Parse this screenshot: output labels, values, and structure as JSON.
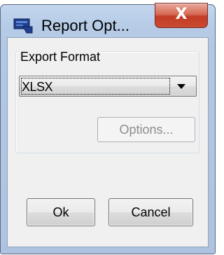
{
  "window": {
    "title": "Report Opt...",
    "icon": "report-app-icon",
    "close_icon": "close-icon",
    "close_glyph": "X"
  },
  "export_group": {
    "label": "Export Format",
    "format_select": {
      "selected_value": "XLSX",
      "arrow_icon": "chevron-down-icon"
    },
    "options_button": {
      "label": "Options...",
      "enabled": false
    }
  },
  "footer": {
    "ok_label": "Ok",
    "cancel_label": "Cancel"
  },
  "colors": {
    "title_bar": "#b6cbe6",
    "close_button": "#c94a32",
    "dialog_background": "#f0f0f0",
    "disabled_text": "#8d8d8d"
  }
}
